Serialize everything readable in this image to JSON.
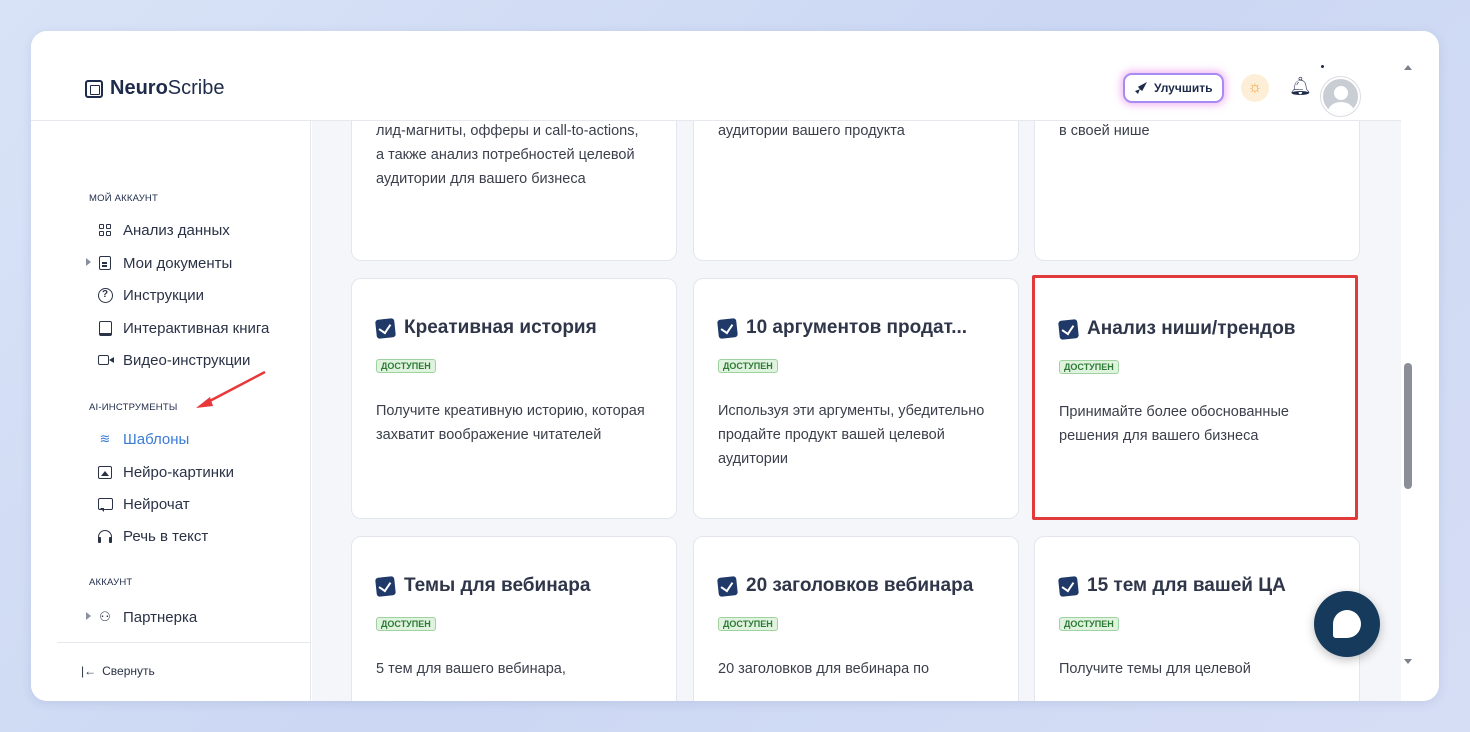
{
  "header": {
    "logo_bold": "Neuro",
    "logo_light": "Scribe",
    "upgrade_label": "Улучшить"
  },
  "sidebar": {
    "sections": [
      {
        "title": "МОЙ АККАУНТ"
      },
      {
        "title": "AI-ИНСТРУМЕНТЫ"
      },
      {
        "title": "АККАУНТ"
      }
    ],
    "items": [
      {
        "label": "Анализ данных"
      },
      {
        "label": "Мои документы"
      },
      {
        "label": "Инструкции"
      },
      {
        "label": "Интерактивная книга"
      },
      {
        "label": "Видео-инструкции"
      },
      {
        "label": "Шаблоны"
      },
      {
        "label": "Нейро-картинки"
      },
      {
        "label": "Нейрочат"
      },
      {
        "label": "Речь в текст"
      },
      {
        "label": "Партнерка"
      }
    ],
    "collapse_label": "Свернуть"
  },
  "cards": {
    "top": [
      {
        "desc": "лид-магниты, офферы и call-to-actions, а также анализ потребностей целевой аудитории для вашего бизнеса"
      },
      {
        "desc": "аудитории вашего продукта"
      },
      {
        "desc": "в своей нише"
      }
    ],
    "middle": [
      {
        "title": "Креативная история",
        "badge": "ДОСТУПЕН",
        "desc": "Получите креативную историю, которая захватит воображение читателей"
      },
      {
        "title": "10 аргументов продат...",
        "badge": "ДОСТУПЕН",
        "desc": "Используя эти аргументы, убедительно продайте продукт вашей целевой аудитории"
      },
      {
        "title": "Анализ ниши/трендов",
        "badge": "ДОСТУПЕН",
        "desc": "Принимайте более обоснованные решения для вашего бизнеса"
      }
    ],
    "bottom": [
      {
        "title": "Темы для вебинара",
        "badge": "ДОСТУПЕН",
        "desc": "5 тем для вашего вебинара,"
      },
      {
        "title": "20 заголовков вебинара",
        "badge": "ДОСТУПЕН",
        "desc": "20 заголовков для вебинара по"
      },
      {
        "title": "15 тем для вашей ЦА",
        "badge": "ДОСТУПЕН",
        "desc": "Получите темы для целевой"
      }
    ]
  },
  "colors": {
    "active_nav": "#3a7bd5",
    "highlight_border": "#e03a3a",
    "badge_green": "#2d7a35",
    "fab": "#153a5c"
  }
}
